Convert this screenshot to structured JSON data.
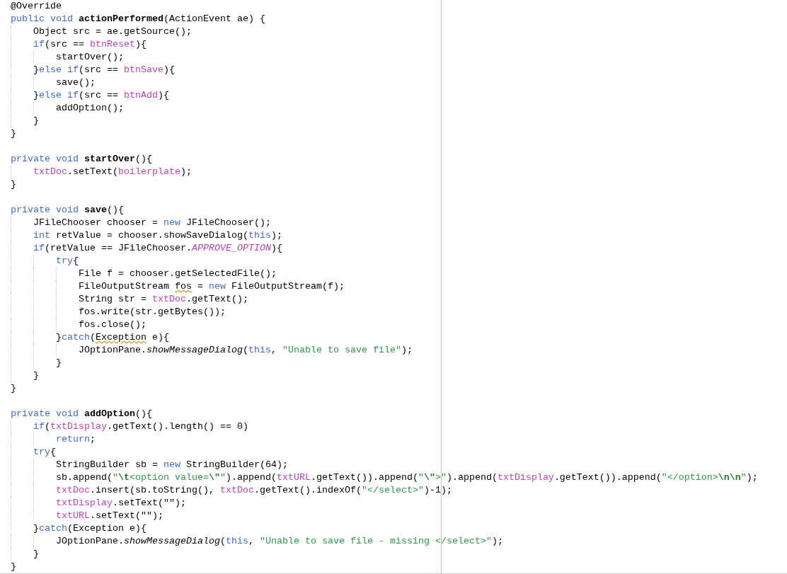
{
  "editor": {
    "lines": [
      {
        "kind": "code",
        "tokens": [
          {
            "kind": "plain",
            "text": "@Override"
          }
        ]
      },
      {
        "kind": "code",
        "tokens": [
          {
            "kind": "keyword",
            "text": "public void "
          },
          {
            "kind": "declaration",
            "text": "actionPerformed"
          },
          {
            "kind": "plain",
            "text": "(ActionEvent ae) {"
          }
        ]
      },
      {
        "kind": "code",
        "tokens": [
          {
            "kind": "plain",
            "text": "    Object src = ae.getSource();"
          }
        ]
      },
      {
        "kind": "code",
        "tokens": [
          {
            "kind": "keyword",
            "text": "    if"
          },
          {
            "kind": "plain",
            "text": "(src == "
          },
          {
            "kind": "field",
            "text": "btnReset"
          },
          {
            "kind": "plain",
            "text": "){"
          }
        ]
      },
      {
        "kind": "code",
        "tokens": [
          {
            "kind": "plain",
            "text": "        startOver();"
          }
        ]
      },
      {
        "kind": "code",
        "tokens": [
          {
            "kind": "plain",
            "text": "    }"
          },
          {
            "kind": "keyword",
            "text": "else if"
          },
          {
            "kind": "plain",
            "text": "(src == "
          },
          {
            "kind": "field",
            "text": "btnSave"
          },
          {
            "kind": "plain",
            "text": "){"
          }
        ]
      },
      {
        "kind": "code",
        "tokens": [
          {
            "kind": "plain",
            "text": "        save();"
          }
        ]
      },
      {
        "kind": "code",
        "tokens": [
          {
            "kind": "plain",
            "text": "    }"
          },
          {
            "kind": "keyword",
            "text": "else if"
          },
          {
            "kind": "plain",
            "text": "(src == "
          },
          {
            "kind": "field",
            "text": "btnAdd"
          },
          {
            "kind": "plain",
            "text": "){"
          }
        ]
      },
      {
        "kind": "code",
        "tokens": [
          {
            "kind": "plain",
            "text": "        addOption();"
          }
        ]
      },
      {
        "kind": "code",
        "tokens": [
          {
            "kind": "plain",
            "text": "    }"
          }
        ]
      },
      {
        "kind": "code",
        "tokens": [
          {
            "kind": "plain",
            "text": "}"
          }
        ]
      },
      {
        "kind": "blank"
      },
      {
        "kind": "code",
        "tokens": [
          {
            "kind": "keyword",
            "text": "private void "
          },
          {
            "kind": "declaration",
            "text": "startOver"
          },
          {
            "kind": "plain",
            "text": "(){"
          }
        ]
      },
      {
        "kind": "code",
        "tokens": [
          {
            "kind": "field",
            "text": "    txtDoc"
          },
          {
            "kind": "plain",
            "text": ".setText("
          },
          {
            "kind": "field",
            "text": "boilerplate"
          },
          {
            "kind": "plain",
            "text": ");"
          }
        ]
      },
      {
        "kind": "code",
        "tokens": [
          {
            "kind": "plain",
            "text": "}"
          }
        ]
      },
      {
        "kind": "blank"
      },
      {
        "kind": "code",
        "tokens": [
          {
            "kind": "keyword",
            "text": "private void "
          },
          {
            "kind": "declaration",
            "text": "save"
          },
          {
            "kind": "plain",
            "text": "(){"
          }
        ]
      },
      {
        "kind": "code",
        "tokens": [
          {
            "kind": "plain",
            "text": "    JFileChooser chooser = "
          },
          {
            "kind": "keyword",
            "text": "new"
          },
          {
            "kind": "plain",
            "text": " JFileChooser();"
          }
        ]
      },
      {
        "kind": "code",
        "tokens": [
          {
            "kind": "keyword",
            "text": "    int"
          },
          {
            "kind": "plain",
            "text": " retValue = chooser.showSaveDialog("
          },
          {
            "kind": "keyword",
            "text": "this"
          },
          {
            "kind": "plain",
            "text": ");"
          }
        ]
      },
      {
        "kind": "code",
        "tokens": [
          {
            "kind": "keyword",
            "text": "    if"
          },
          {
            "kind": "plain",
            "text": "(retValue == JFileChooser."
          },
          {
            "kind": "constant",
            "text": "APPROVE_OPTION"
          },
          {
            "kind": "plain",
            "text": "){"
          }
        ]
      },
      {
        "kind": "code",
        "tokens": [
          {
            "kind": "keyword",
            "text": "        try"
          },
          {
            "kind": "plain",
            "text": "{"
          }
        ]
      },
      {
        "kind": "code",
        "tokens": [
          {
            "kind": "plain",
            "text": "            File f = chooser.getSelectedFile();"
          }
        ]
      },
      {
        "kind": "code",
        "tokens": [
          {
            "kind": "plain",
            "text": "            FileOutputStream "
          },
          {
            "kind": "warning",
            "text": "fos"
          },
          {
            "kind": "plain",
            "text": " = "
          },
          {
            "kind": "keyword",
            "text": "new"
          },
          {
            "kind": "plain",
            "text": " FileOutputStream(f);"
          }
        ]
      },
      {
        "kind": "code",
        "tokens": [
          {
            "kind": "plain",
            "text": "            String str = "
          },
          {
            "kind": "field",
            "text": "txtDoc"
          },
          {
            "kind": "plain",
            "text": ".getText();"
          }
        ]
      },
      {
        "kind": "code",
        "tokens": [
          {
            "kind": "plain",
            "text": "            fos.write(str.getBytes());"
          }
        ]
      },
      {
        "kind": "code",
        "tokens": [
          {
            "kind": "plain",
            "text": "            fos.close();"
          }
        ]
      },
      {
        "kind": "code",
        "tokens": [
          {
            "kind": "plain",
            "text": "        }"
          },
          {
            "kind": "keyword",
            "text": "catch"
          },
          {
            "kind": "plain",
            "text": "("
          },
          {
            "kind": "warning",
            "text": "Exception"
          },
          {
            "kind": "plain",
            "text": " e){"
          }
        ]
      },
      {
        "kind": "code",
        "tokens": [
          {
            "kind": "plain",
            "text": "            JOptionPane."
          },
          {
            "kind": "static",
            "text": "showMessageDialog"
          },
          {
            "kind": "plain",
            "text": "("
          },
          {
            "kind": "keyword",
            "text": "this"
          },
          {
            "kind": "plain",
            "text": ", "
          },
          {
            "kind": "string",
            "text": "\"Unable to save file\""
          },
          {
            "kind": "plain",
            "text": ");"
          }
        ]
      },
      {
        "kind": "code",
        "tokens": [
          {
            "kind": "plain",
            "text": "        }"
          }
        ]
      },
      {
        "kind": "code",
        "tokens": [
          {
            "kind": "plain",
            "text": "    }"
          }
        ]
      },
      {
        "kind": "code",
        "tokens": [
          {
            "kind": "plain",
            "text": "}"
          }
        ]
      },
      {
        "kind": "blank"
      },
      {
        "kind": "code",
        "tokens": [
          {
            "kind": "keyword",
            "text": "private void "
          },
          {
            "kind": "declaration",
            "text": "addOption"
          },
          {
            "kind": "plain",
            "text": "(){"
          }
        ]
      },
      {
        "kind": "code",
        "tokens": [
          {
            "kind": "keyword",
            "text": "    if"
          },
          {
            "kind": "plain",
            "text": "("
          },
          {
            "kind": "field",
            "text": "txtDisplay"
          },
          {
            "kind": "plain",
            "text": ".getText().length() == 0)"
          }
        ]
      },
      {
        "kind": "code",
        "tokens": [
          {
            "kind": "keyword",
            "text": "        return"
          },
          {
            "kind": "plain",
            "text": ";"
          }
        ]
      },
      {
        "kind": "code",
        "tokens": [
          {
            "kind": "keyword",
            "text": "    try"
          },
          {
            "kind": "plain",
            "text": "{"
          }
        ]
      },
      {
        "kind": "code",
        "tokens": [
          {
            "kind": "plain",
            "text": "        StringBuilder sb = "
          },
          {
            "kind": "keyword",
            "text": "new"
          },
          {
            "kind": "plain",
            "text": " StringBuilder(64);"
          }
        ]
      },
      {
        "kind": "code",
        "tokens": [
          {
            "kind": "plain",
            "text": "        sb.append("
          },
          {
            "kind": "string",
            "text": "\""
          },
          {
            "kind": "escape",
            "text": "\\t"
          },
          {
            "kind": "string",
            "text": "<option value="
          },
          {
            "kind": "escape",
            "text": "\\\""
          },
          {
            "kind": "string",
            "text": "\""
          },
          {
            "kind": "plain",
            "text": ").append("
          },
          {
            "kind": "field",
            "text": "txtURL"
          },
          {
            "kind": "plain",
            "text": ".getText()).append("
          },
          {
            "kind": "string",
            "text": "\""
          },
          {
            "kind": "escape",
            "text": "\\\""
          },
          {
            "kind": "string",
            "text": ">\""
          },
          {
            "kind": "plain",
            "text": ").append("
          },
          {
            "kind": "field",
            "text": "txtDisplay"
          },
          {
            "kind": "plain",
            "text": ".getText()).append("
          },
          {
            "kind": "string",
            "text": "\"</option>"
          },
          {
            "kind": "escape",
            "text": "\\n\\n"
          },
          {
            "kind": "string",
            "text": "\""
          },
          {
            "kind": "plain",
            "text": ");"
          }
        ]
      },
      {
        "kind": "code",
        "tokens": [
          {
            "kind": "field",
            "text": "        txtDoc"
          },
          {
            "kind": "plain",
            "text": ".insert(sb.toString(), "
          },
          {
            "kind": "field",
            "text": "txtDoc"
          },
          {
            "kind": "plain",
            "text": ".getText().indexOf("
          },
          {
            "kind": "string",
            "text": "\"</select>\""
          },
          {
            "kind": "plain",
            "text": ")-1);"
          }
        ]
      },
      {
        "kind": "code",
        "tokens": [
          {
            "kind": "field",
            "text": "        txtDisplay"
          },
          {
            "kind": "plain",
            "text": ".setText(\"\");"
          }
        ]
      },
      {
        "kind": "code",
        "tokens": [
          {
            "kind": "field",
            "text": "        txtURL"
          },
          {
            "kind": "plain",
            "text": ".setText(\"\");"
          }
        ]
      },
      {
        "kind": "code",
        "tokens": [
          {
            "kind": "plain",
            "text": "    }"
          },
          {
            "kind": "keyword",
            "text": "catch"
          },
          {
            "kind": "plain",
            "text": "(Exception e){"
          }
        ]
      },
      {
        "kind": "code",
        "tokens": [
          {
            "kind": "plain",
            "text": "        JOptionPane."
          },
          {
            "kind": "static",
            "text": "showMessageDialog"
          },
          {
            "kind": "plain",
            "text": "("
          },
          {
            "kind": "keyword",
            "text": "this"
          },
          {
            "kind": "plain",
            "text": ", "
          },
          {
            "kind": "string",
            "text": "\"Unable to save file - missing </select>\""
          },
          {
            "kind": "plain",
            "text": ");"
          }
        ]
      },
      {
        "kind": "code",
        "tokens": [
          {
            "kind": "plain",
            "text": "    }"
          }
        ]
      },
      {
        "kind": "code",
        "tokens": [
          {
            "kind": "plain",
            "text": "}"
          }
        ]
      }
    ]
  }
}
